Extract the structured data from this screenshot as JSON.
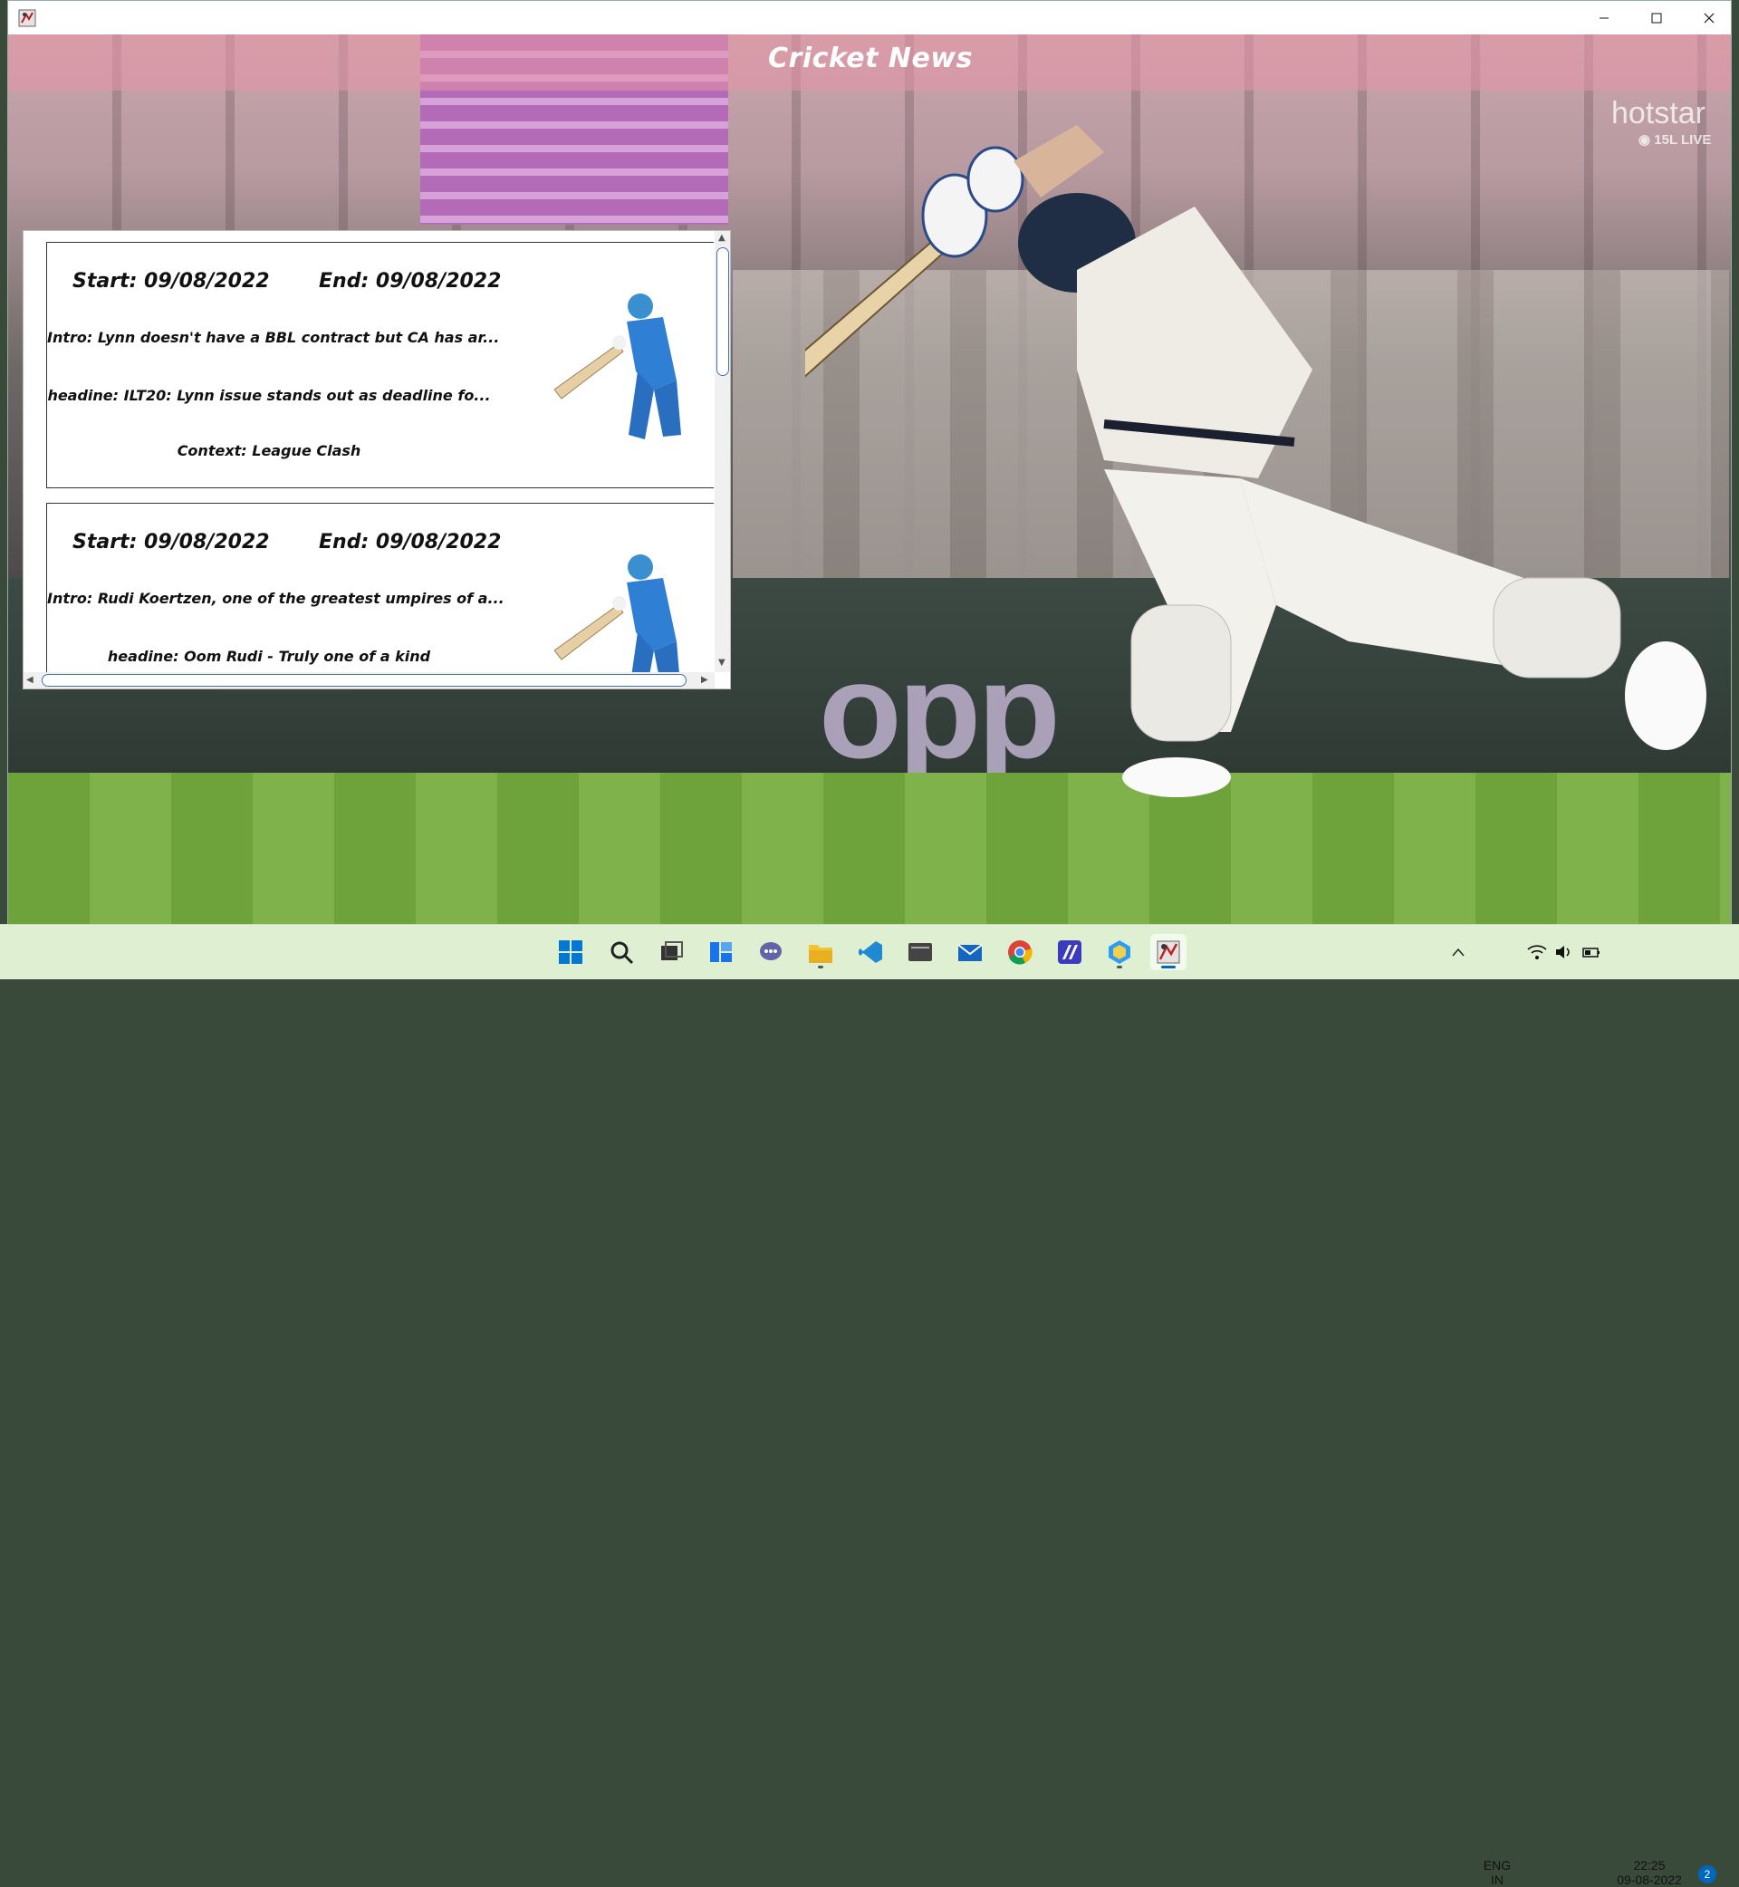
{
  "window": {
    "title": "",
    "app_title": "Cricket News"
  },
  "background": {
    "watermark": "hotstar",
    "watermark_live": "15L LIVE",
    "board_logo": "opp"
  },
  "news": [
    {
      "start_label": "Start: 09/08/2022",
      "end_label": "End: 09/08/2022",
      "intro": "Intro: Lynn doesn't have a BBL contract but CA has ar...",
      "headline": "headine: ILT20: Lynn issue stands out as deadline fo...",
      "context": "Context: League Clash"
    },
    {
      "start_label": "Start: 09/08/2022",
      "end_label": "End: 09/08/2022",
      "intro": "Intro: Rudi Koertzen, one of the greatest umpires of a...",
      "headline": "headine: Oom Rudi - Truly one of a kind",
      "context": ""
    }
  ],
  "taskbar": {
    "apps": [
      "start-icon",
      "search-icon",
      "task-view-icon",
      "widgets-icon",
      "chat-icon",
      "file-explorer-icon",
      "vscode-icon",
      "terminal-icon",
      "mail-icon",
      "chrome-icon",
      "editor-icon",
      "app-hex-icon",
      "java-app-icon"
    ],
    "language_top": "ENG",
    "language_bottom": "IN",
    "time": "22:25",
    "date": "09-08-2022",
    "notifications": "2"
  },
  "colors": {
    "taskbar_bg": "#dff0d2",
    "accent": "#0067c0",
    "title_text": "#ffffff"
  }
}
